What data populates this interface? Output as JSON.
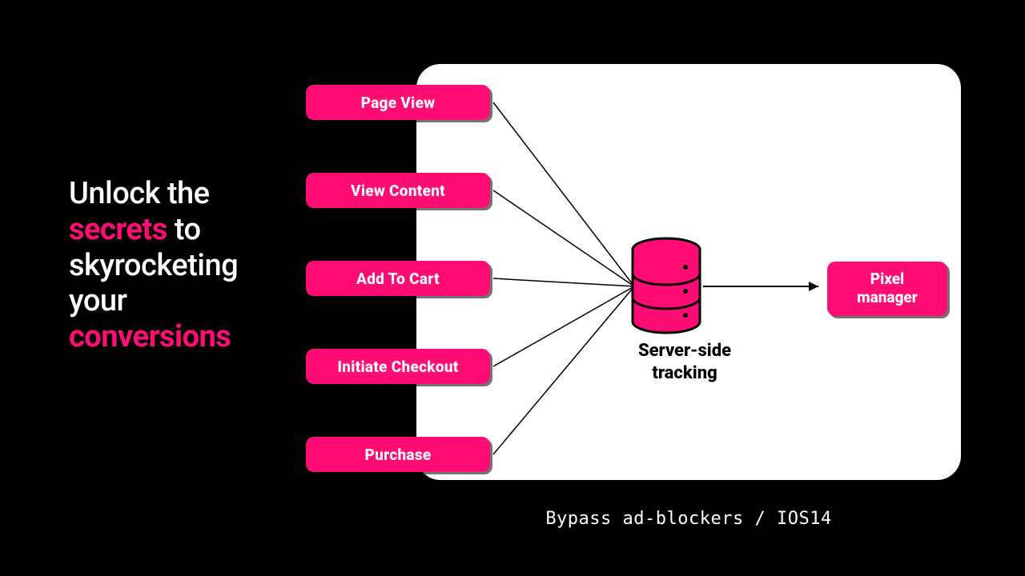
{
  "colors": {
    "accent": "#ff0d74",
    "bg": "#000000",
    "panel": "#ffffff"
  },
  "headline": {
    "t1": "Unlock the",
    "accent1": "secrets",
    "t2": " to skyrocketing your ",
    "accent2": "conversions"
  },
  "events": [
    {
      "label": "Page View"
    },
    {
      "label": "View Content"
    },
    {
      "label": "Add To Cart"
    },
    {
      "label": "Initiate Checkout"
    },
    {
      "label": "Purchase"
    }
  ],
  "server": {
    "label_line1": "Server-side",
    "label_line2": "tracking"
  },
  "destination": {
    "label_line1": "Pixel",
    "label_line2": "manager"
  },
  "caption": "Bypass ad-blockers / IOS14"
}
